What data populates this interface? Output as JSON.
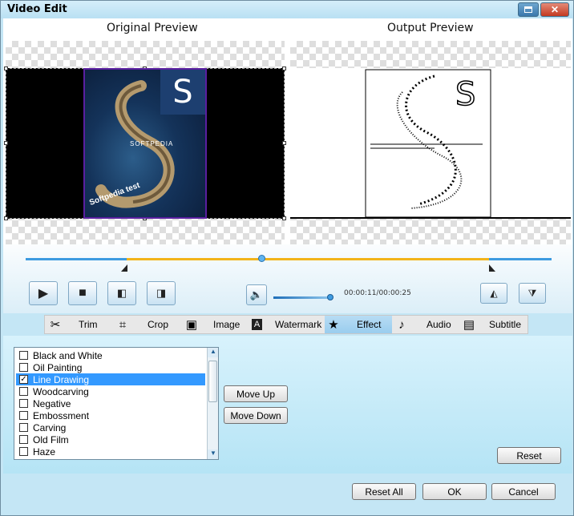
{
  "window": {
    "title": "Video Edit",
    "close_label": "✕"
  },
  "preview": {
    "original_title": "Original Preview",
    "output_title": "Output Preview",
    "watermark_text": "Softpedia test",
    "thumb_caption": "SOFTPEDIA"
  },
  "playback": {
    "time": "00:00:11/00:00:25"
  },
  "tabs": [
    {
      "label": "Trim",
      "icon": "scissors-icon",
      "glyph": "✂"
    },
    {
      "label": "Crop",
      "icon": "crop-icon",
      "glyph": "⌗"
    },
    {
      "label": "Image",
      "icon": "image-icon",
      "glyph": "▣"
    },
    {
      "label": "Watermark",
      "icon": "watermark-icon",
      "glyph": "A"
    },
    {
      "label": "Effect",
      "icon": "star-icon",
      "glyph": "★"
    },
    {
      "label": "Audio",
      "icon": "music-note-icon",
      "glyph": "♪"
    },
    {
      "label": "Subtitle",
      "icon": "subtitle-icon",
      "glyph": "▤"
    }
  ],
  "effects": [
    {
      "label": "Black and White",
      "checked": false
    },
    {
      "label": "Oil Painting",
      "checked": false
    },
    {
      "label": "Line Drawing",
      "checked": true
    },
    {
      "label": "Woodcarving",
      "checked": false
    },
    {
      "label": "Negative",
      "checked": false
    },
    {
      "label": "Embossment",
      "checked": false
    },
    {
      "label": "Carving",
      "checked": false
    },
    {
      "label": "Old Film",
      "checked": false
    },
    {
      "label": "Haze",
      "checked": false
    }
  ],
  "buttons": {
    "move_up": "Move Up",
    "move_down": "Move Down",
    "reset": "Reset",
    "reset_all": "Reset All",
    "ok": "OK",
    "cancel": "Cancel"
  },
  "colors": {
    "accent": "#3399ff",
    "progress": "#f2b41a",
    "track": "#3d9be0"
  }
}
